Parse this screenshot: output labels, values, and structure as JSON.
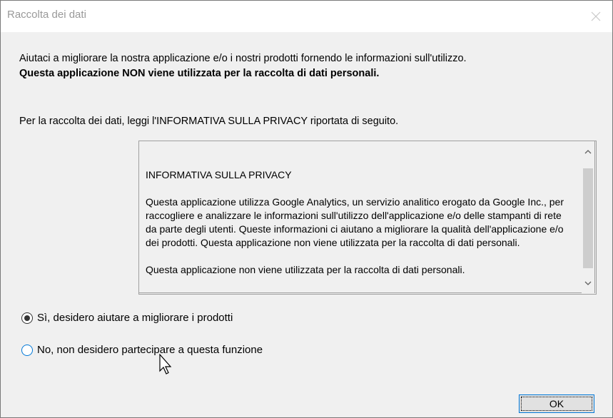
{
  "window": {
    "title": "Raccolta dei dati"
  },
  "intro": {
    "line1": "Aiutaci a migliorare la nostra applicazione e/o i nostri prodotti fornendo le informazioni sull'utilizzo.",
    "line2_bold": "Questa applicazione NON viene utilizzata per la raccolta di dati personali."
  },
  "privacy_hint": "Per la raccolta dei dati, leggi l'INFORMATIVA SULLA PRIVACY riportata di seguito.",
  "policy": {
    "heading": "INFORMATIVA SULLA PRIVACY",
    "paragraph1": "Questa applicazione utilizza Google Analytics, un servizio analitico erogato da Google Inc., per raccogliere e analizzare le informazioni sull'utilizzo dell'applicazione e/o delle stampanti di rete da parte degli utenti. Queste informazioni ci aiutano a migliorare la qualità dell'applicazione e/o dei prodotti. Questa applicazione non viene utilizzata per la raccolta di dati personali.",
    "paragraph2": "Questa applicazione non viene utilizzata per la raccolta di dati personali."
  },
  "options": {
    "yes_label": "Sì, desidero aiutare a migliorare i prodotti",
    "no_label": "No, non desidero partecipare a questa funzione",
    "selected": "yes"
  },
  "buttons": {
    "ok_label": "OK"
  },
  "icons": {
    "close": "close-icon",
    "scroll_up": "chevron-up-icon",
    "scroll_down": "chevron-down-icon",
    "cursor": "mouse-pointer-icon"
  }
}
